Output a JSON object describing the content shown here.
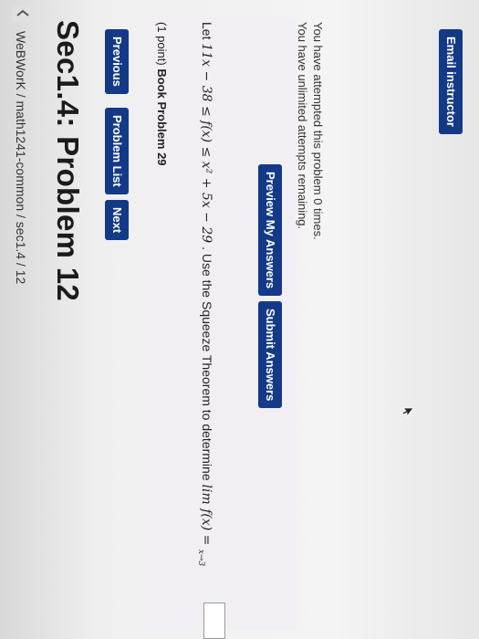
{
  "breadcrumb": "WeBWorK / math1241-common / sec1.4 / 12",
  "page_title": "Sec1.4: Problem 12",
  "nav": {
    "previous_label": "Previous",
    "problem_list_label": "Problem List",
    "next_label": "Next"
  },
  "problem": {
    "points": "(1 point)",
    "book_problem": "Book Problem 29",
    "statement_prefix": "Let",
    "inequality": "11x − 38 ≤ f(x) ≤ x² + 5x − 29",
    "statement_middle": ". Use the Squeeze Theorem to determine",
    "limit_expression": "lim f(x) =",
    "limit_subscript": "x→3",
    "answer_value": ""
  },
  "actions": {
    "preview_label": "Preview My Answers",
    "submit_label": "Submit Answers"
  },
  "attempts": {
    "line1": "You have attempted this problem 0 times.",
    "line2": "You have unlimited attempts remaining."
  },
  "email_label": "Email instructor",
  "icons": {
    "back": "chevron-left-icon",
    "cursor": "mouse-pointer-icon"
  },
  "colors": {
    "button_bg": "#143a87",
    "problem_bg": "#f1eff4"
  }
}
